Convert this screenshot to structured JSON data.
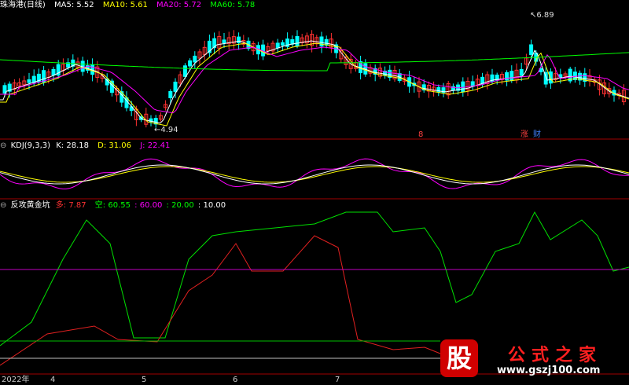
{
  "main_panel": {
    "title": "珠海港(日线)",
    "indicators": [
      {
        "label": "MA5: 5.52",
        "color": "#ffffff"
      },
      {
        "label": "MA10: 5.61",
        "color": "#ffff00"
      },
      {
        "label": "MA20: 5.72",
        "color": "#ff00ff"
      },
      {
        "label": "MA60: 5.78",
        "color": "#00ff00"
      }
    ],
    "high_marker": "6.89",
    "low_marker": "4.94",
    "event_tags": [
      {
        "text": "8",
        "color": "#ff4040"
      },
      {
        "text": "涨",
        "color": "#ff4040"
      },
      {
        "text": "财",
        "color": "#4080ff"
      }
    ]
  },
  "kdj_panel": {
    "name": "KDJ(9,3,3)",
    "k": "K: 28.18",
    "d": "D: 31.06",
    "j": "J: 22.41"
  },
  "fg_panel": {
    "name": "反攻黄金坑",
    "duo": "多: 7.87",
    "kong": "空: 60.55",
    "l60": ": 60.00",
    "l20": ": 20.00",
    "l10": ": 10.00"
  },
  "x_axis": {
    "labels": [
      "2022年",
      "4",
      "5",
      "6",
      "7"
    ]
  },
  "watermark": {
    "char": "股",
    "name": "公式之家",
    "url": "www.gszj100.com"
  },
  "colors": {
    "up": "#ff3232",
    "down": "#00ffff",
    "ma5": "#ffffff",
    "ma10": "#ffff00",
    "ma20": "#ff00ff",
    "ma60": "#00ff00",
    "separator": "#a00000"
  }
}
